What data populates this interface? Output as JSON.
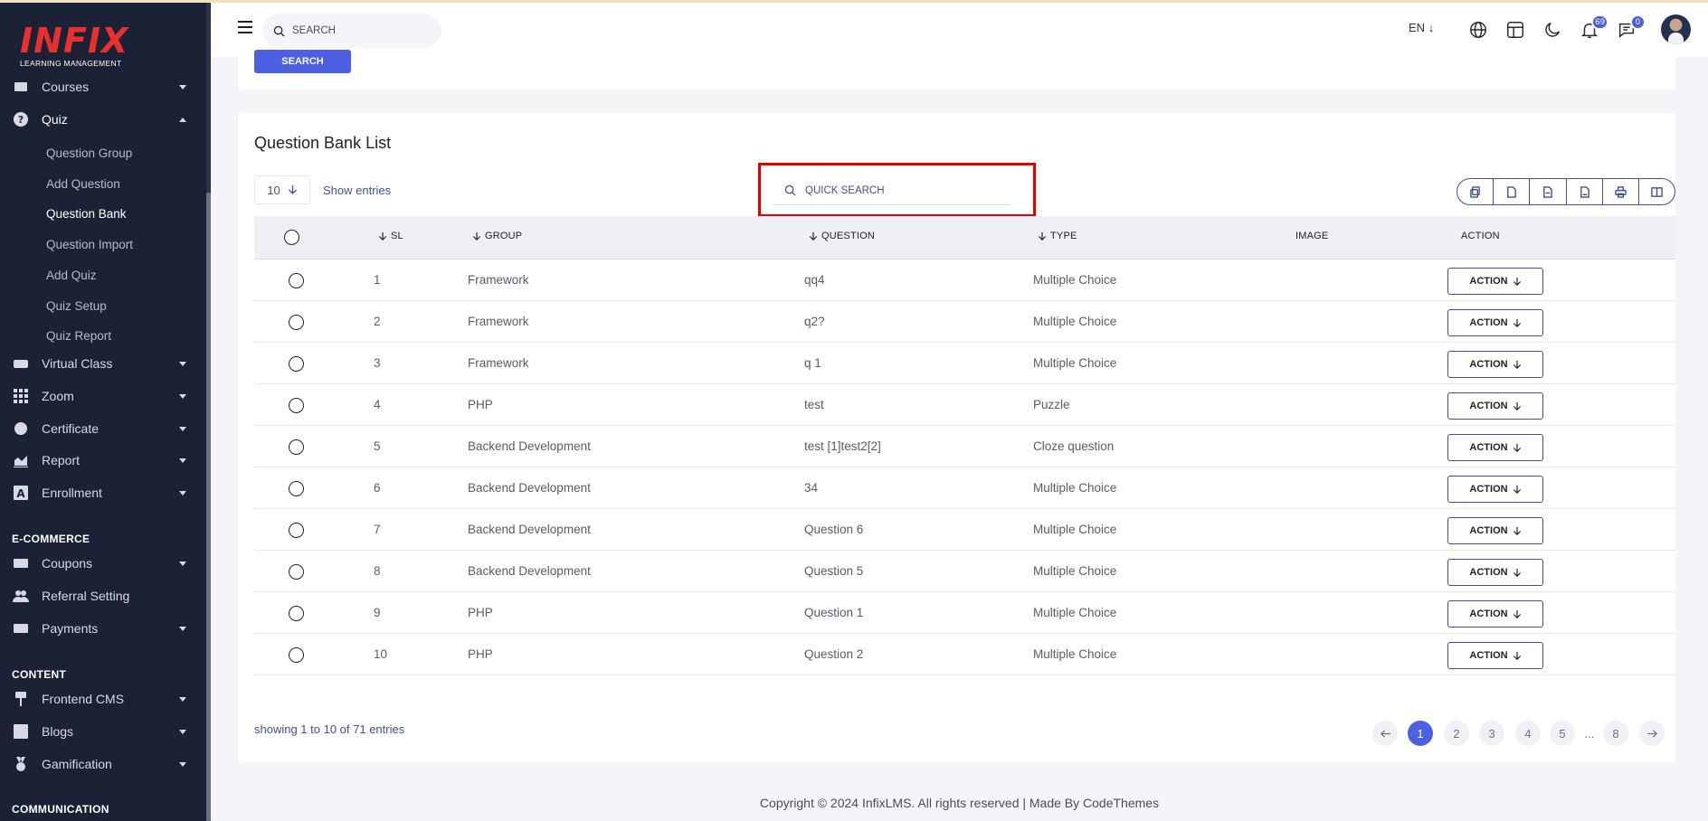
{
  "brand": {
    "logo": "INFIX",
    "tagline": "LEARNING MANAGEMENT"
  },
  "header": {
    "search_placeholder": "SEARCH",
    "language": "EN",
    "notification_count": "69",
    "message_count": "0"
  },
  "top_card": {
    "button_label": "SEARCH"
  },
  "sidebar": {
    "items": [
      {
        "label": "Courses",
        "icon": "courses-icon"
      },
      {
        "label": "Quiz",
        "icon": "quiz-icon"
      },
      {
        "label": "Virtual Class",
        "icon": "vr-icon"
      },
      {
        "label": "Zoom",
        "icon": "grid-icon"
      },
      {
        "label": "Certificate",
        "icon": "certificate-icon"
      },
      {
        "label": "Report",
        "icon": "chart-icon"
      },
      {
        "label": "Enrollment",
        "icon": "enrollment-icon"
      },
      {
        "label": "Coupons",
        "icon": "coupon-icon"
      },
      {
        "label": "Referral Setting",
        "icon": "users-icon"
      },
      {
        "label": "Payments",
        "icon": "payment-icon"
      },
      {
        "label": "Frontend CMS",
        "icon": "brush-icon"
      },
      {
        "label": "Blogs",
        "icon": "blog-icon"
      },
      {
        "label": "Gamification",
        "icon": "medal-icon"
      }
    ],
    "quiz_sub": [
      "Question Group",
      "Add Question",
      "Question Bank",
      "Question Import",
      "Add Quiz",
      "Quiz Setup",
      "Quiz Report"
    ],
    "sections": [
      "E-COMMERCE",
      "CONTENT",
      "COMMUNICATION"
    ]
  },
  "main": {
    "title": "Question Bank List",
    "entries_value": "10",
    "show_entries": "Show entries",
    "quick_search_placeholder": "QUICK SEARCH",
    "columns": {
      "sl": "SL",
      "group": "GROUP",
      "question": "QUESTION",
      "type": "TYPE",
      "image": "IMAGE",
      "action": "ACTION"
    },
    "action_label": "ACTION",
    "rows": [
      {
        "sl": "1",
        "group": "Framework",
        "question": "qq4",
        "type": "Multiple Choice"
      },
      {
        "sl": "2",
        "group": "Framework",
        "question": "q2?",
        "type": "Multiple Choice"
      },
      {
        "sl": "3",
        "group": "Framework",
        "question": "q 1",
        "type": "Multiple Choice"
      },
      {
        "sl": "4",
        "group": "PHP",
        "question": "test",
        "type": "Puzzle"
      },
      {
        "sl": "5",
        "group": "Backend Development",
        "question": "test [1]test2[2]",
        "type": "Cloze question"
      },
      {
        "sl": "6",
        "group": "Backend Development",
        "question": "34",
        "type": "Multiple Choice"
      },
      {
        "sl": "7",
        "group": "Backend Development",
        "question": "Question 6",
        "type": "Multiple Choice"
      },
      {
        "sl": "8",
        "group": "Backend Development",
        "question": "Question 5",
        "type": "Multiple Choice"
      },
      {
        "sl": "9",
        "group": "PHP",
        "question": "Question 1",
        "type": "Multiple Choice"
      },
      {
        "sl": "10",
        "group": "PHP",
        "question": "Question 2",
        "type": "Multiple Choice"
      }
    ],
    "showing": "showing 1 to 10 of 71 entries",
    "pages": [
      "1",
      "2",
      "3",
      "4",
      "5",
      "...",
      "8"
    ]
  },
  "footer": {
    "text": "Copyright © 2024 InfixLMS. All rights reserved | Made By CodeThemes"
  },
  "colors": {
    "sidebar_bg": "#1c2235",
    "accent": "#4d5fe3",
    "text_link": "#415094",
    "highlight": "#e10000"
  }
}
